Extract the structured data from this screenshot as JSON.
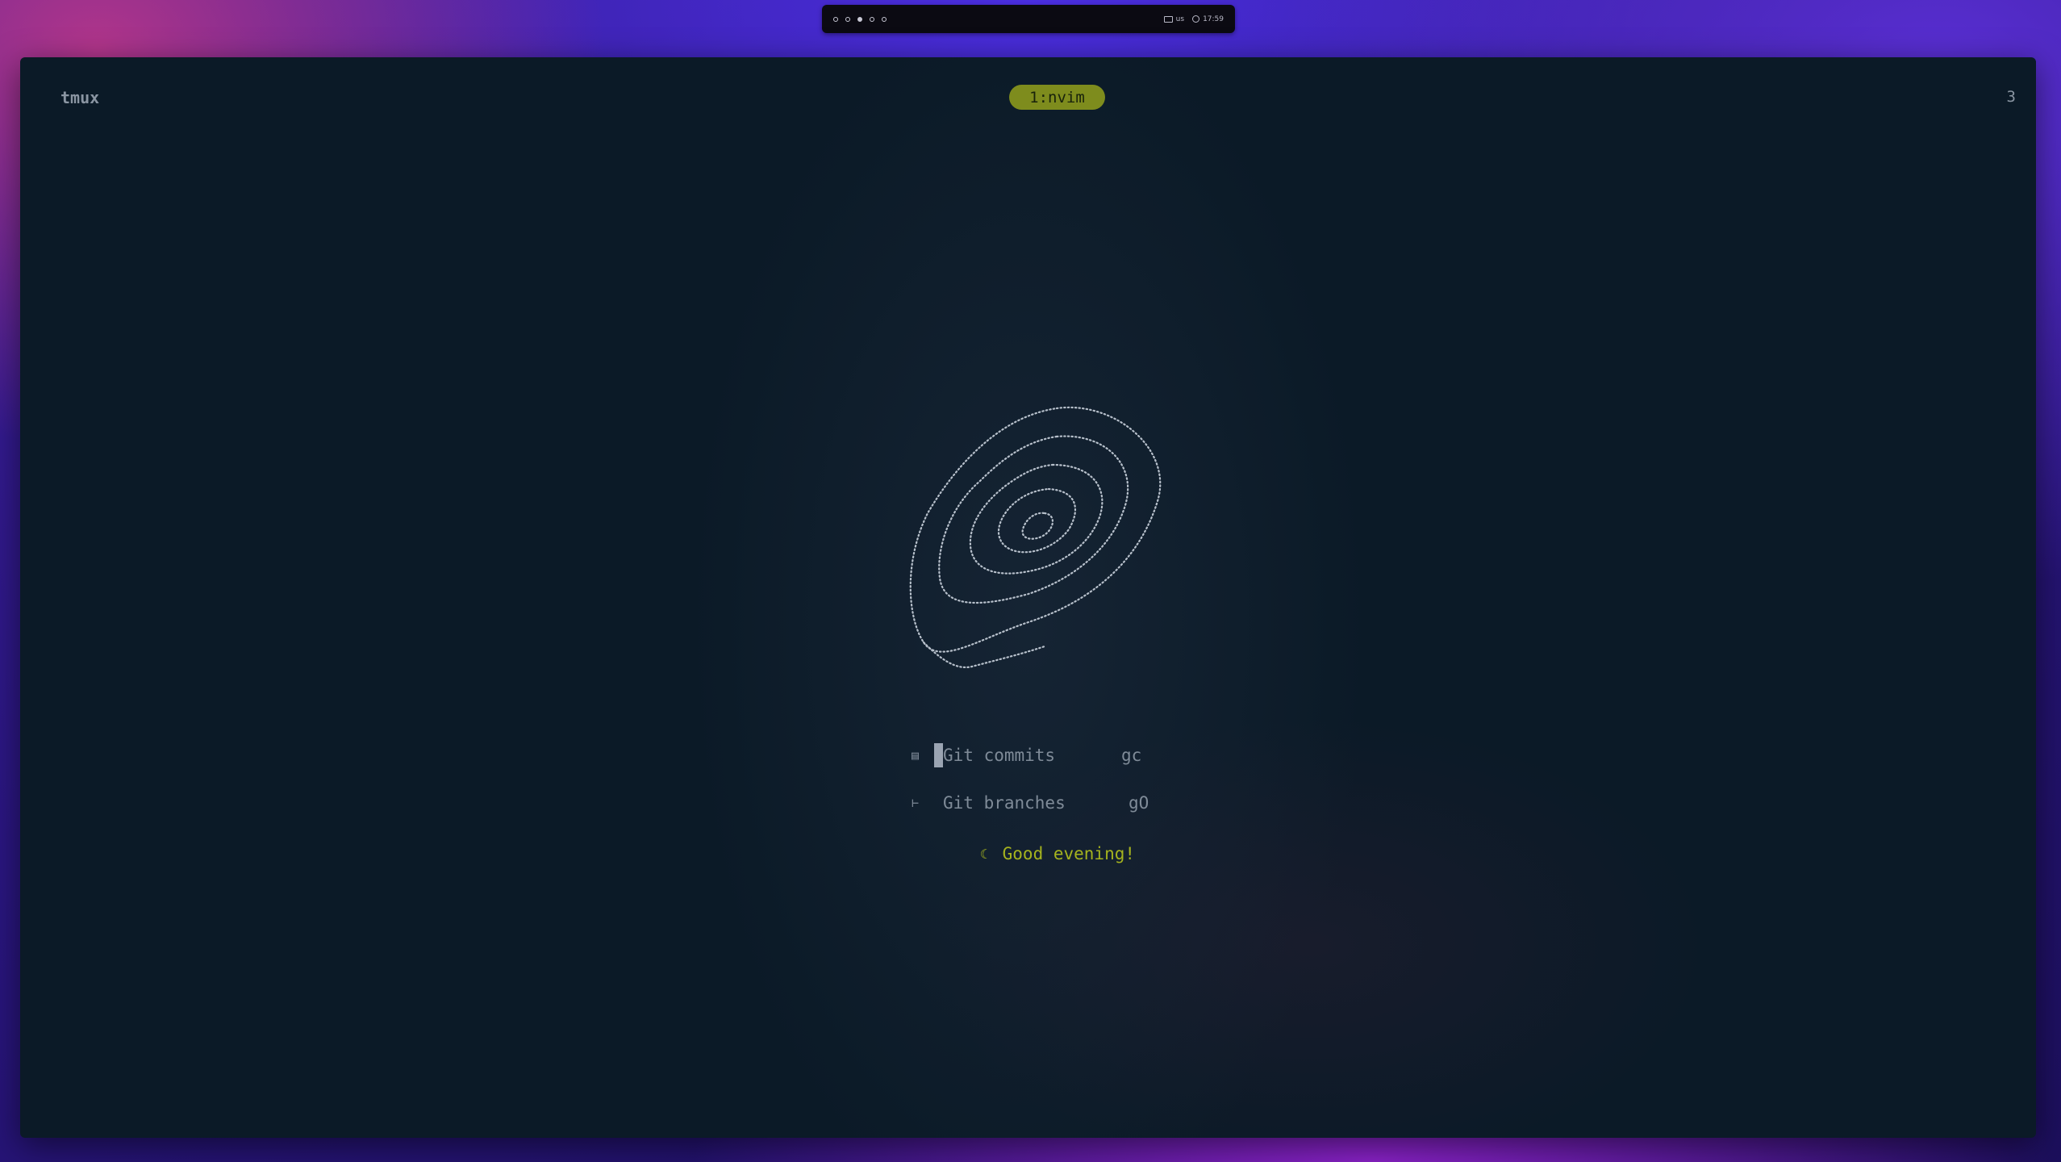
{
  "topbar": {
    "workspaces": [
      {
        "name": "ws-1",
        "active": false
      },
      {
        "name": "ws-2",
        "active": false
      },
      {
        "name": "ws-3",
        "active": true
      },
      {
        "name": "ws-4",
        "active": false
      },
      {
        "name": "ws-5",
        "active": false
      }
    ],
    "keyboard_layout": "us",
    "clock": "17:59"
  },
  "tmux": {
    "session_label": "tmux",
    "window_tab": "1:nvim",
    "pane_count": "3"
  },
  "dashboard": {
    "items": [
      {
        "icon": "git-commit-icon",
        "label": "Git commits",
        "key": "gc"
      },
      {
        "icon": "git-branch-icon",
        "label": "Git branches",
        "key": "gO"
      }
    ],
    "greeting": {
      "icon": "moon-icon",
      "text": "Good evening!"
    }
  },
  "colors": {
    "accent": "#7e8c1d",
    "greeting": "#a5b31e",
    "terminal_bg": "#0b1a27"
  }
}
